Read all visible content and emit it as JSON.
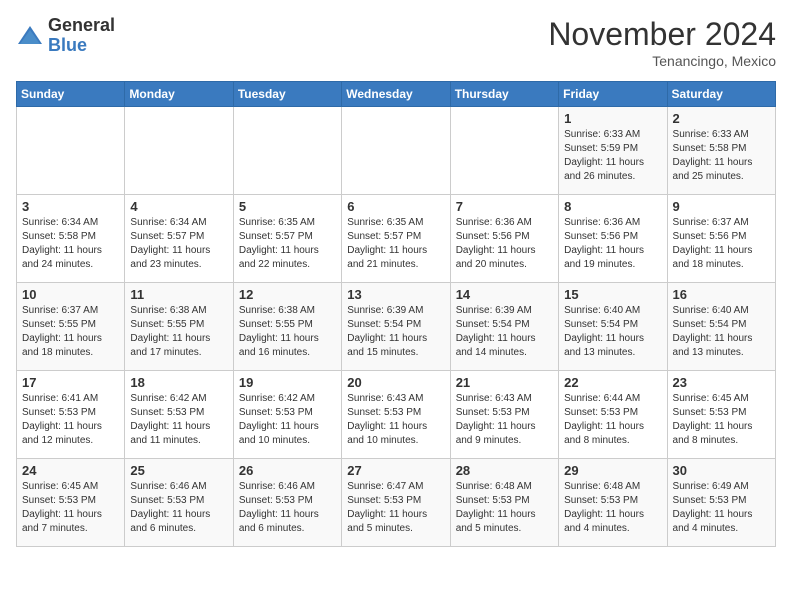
{
  "header": {
    "logo": {
      "general": "General",
      "blue": "Blue"
    },
    "title": "November 2024",
    "location": "Tenancingo, Mexico"
  },
  "weekdays": [
    "Sunday",
    "Monday",
    "Tuesday",
    "Wednesday",
    "Thursday",
    "Friday",
    "Saturday"
  ],
  "weeks": [
    [
      {
        "day": "",
        "info": ""
      },
      {
        "day": "",
        "info": ""
      },
      {
        "day": "",
        "info": ""
      },
      {
        "day": "",
        "info": ""
      },
      {
        "day": "",
        "info": ""
      },
      {
        "day": "1",
        "info": "Sunrise: 6:33 AM\nSunset: 5:59 PM\nDaylight: 11 hours and 26 minutes."
      },
      {
        "day": "2",
        "info": "Sunrise: 6:33 AM\nSunset: 5:58 PM\nDaylight: 11 hours and 25 minutes."
      }
    ],
    [
      {
        "day": "3",
        "info": "Sunrise: 6:34 AM\nSunset: 5:58 PM\nDaylight: 11 hours and 24 minutes."
      },
      {
        "day": "4",
        "info": "Sunrise: 6:34 AM\nSunset: 5:57 PM\nDaylight: 11 hours and 23 minutes."
      },
      {
        "day": "5",
        "info": "Sunrise: 6:35 AM\nSunset: 5:57 PM\nDaylight: 11 hours and 22 minutes."
      },
      {
        "day": "6",
        "info": "Sunrise: 6:35 AM\nSunset: 5:57 PM\nDaylight: 11 hours and 21 minutes."
      },
      {
        "day": "7",
        "info": "Sunrise: 6:36 AM\nSunset: 5:56 PM\nDaylight: 11 hours and 20 minutes."
      },
      {
        "day": "8",
        "info": "Sunrise: 6:36 AM\nSunset: 5:56 PM\nDaylight: 11 hours and 19 minutes."
      },
      {
        "day": "9",
        "info": "Sunrise: 6:37 AM\nSunset: 5:56 PM\nDaylight: 11 hours and 18 minutes."
      }
    ],
    [
      {
        "day": "10",
        "info": "Sunrise: 6:37 AM\nSunset: 5:55 PM\nDaylight: 11 hours and 18 minutes."
      },
      {
        "day": "11",
        "info": "Sunrise: 6:38 AM\nSunset: 5:55 PM\nDaylight: 11 hours and 17 minutes."
      },
      {
        "day": "12",
        "info": "Sunrise: 6:38 AM\nSunset: 5:55 PM\nDaylight: 11 hours and 16 minutes."
      },
      {
        "day": "13",
        "info": "Sunrise: 6:39 AM\nSunset: 5:54 PM\nDaylight: 11 hours and 15 minutes."
      },
      {
        "day": "14",
        "info": "Sunrise: 6:39 AM\nSunset: 5:54 PM\nDaylight: 11 hours and 14 minutes."
      },
      {
        "day": "15",
        "info": "Sunrise: 6:40 AM\nSunset: 5:54 PM\nDaylight: 11 hours and 13 minutes."
      },
      {
        "day": "16",
        "info": "Sunrise: 6:40 AM\nSunset: 5:54 PM\nDaylight: 11 hours and 13 minutes."
      }
    ],
    [
      {
        "day": "17",
        "info": "Sunrise: 6:41 AM\nSunset: 5:53 PM\nDaylight: 11 hours and 12 minutes."
      },
      {
        "day": "18",
        "info": "Sunrise: 6:42 AM\nSunset: 5:53 PM\nDaylight: 11 hours and 11 minutes."
      },
      {
        "day": "19",
        "info": "Sunrise: 6:42 AM\nSunset: 5:53 PM\nDaylight: 11 hours and 10 minutes."
      },
      {
        "day": "20",
        "info": "Sunrise: 6:43 AM\nSunset: 5:53 PM\nDaylight: 11 hours and 10 minutes."
      },
      {
        "day": "21",
        "info": "Sunrise: 6:43 AM\nSunset: 5:53 PM\nDaylight: 11 hours and 9 minutes."
      },
      {
        "day": "22",
        "info": "Sunrise: 6:44 AM\nSunset: 5:53 PM\nDaylight: 11 hours and 8 minutes."
      },
      {
        "day": "23",
        "info": "Sunrise: 6:45 AM\nSunset: 5:53 PM\nDaylight: 11 hours and 8 minutes."
      }
    ],
    [
      {
        "day": "24",
        "info": "Sunrise: 6:45 AM\nSunset: 5:53 PM\nDaylight: 11 hours and 7 minutes."
      },
      {
        "day": "25",
        "info": "Sunrise: 6:46 AM\nSunset: 5:53 PM\nDaylight: 11 hours and 6 minutes."
      },
      {
        "day": "26",
        "info": "Sunrise: 6:46 AM\nSunset: 5:53 PM\nDaylight: 11 hours and 6 minutes."
      },
      {
        "day": "27",
        "info": "Sunrise: 6:47 AM\nSunset: 5:53 PM\nDaylight: 11 hours and 5 minutes."
      },
      {
        "day": "28",
        "info": "Sunrise: 6:48 AM\nSunset: 5:53 PM\nDaylight: 11 hours and 5 minutes."
      },
      {
        "day": "29",
        "info": "Sunrise: 6:48 AM\nSunset: 5:53 PM\nDaylight: 11 hours and 4 minutes."
      },
      {
        "day": "30",
        "info": "Sunrise: 6:49 AM\nSunset: 5:53 PM\nDaylight: 11 hours and 4 minutes."
      }
    ]
  ]
}
